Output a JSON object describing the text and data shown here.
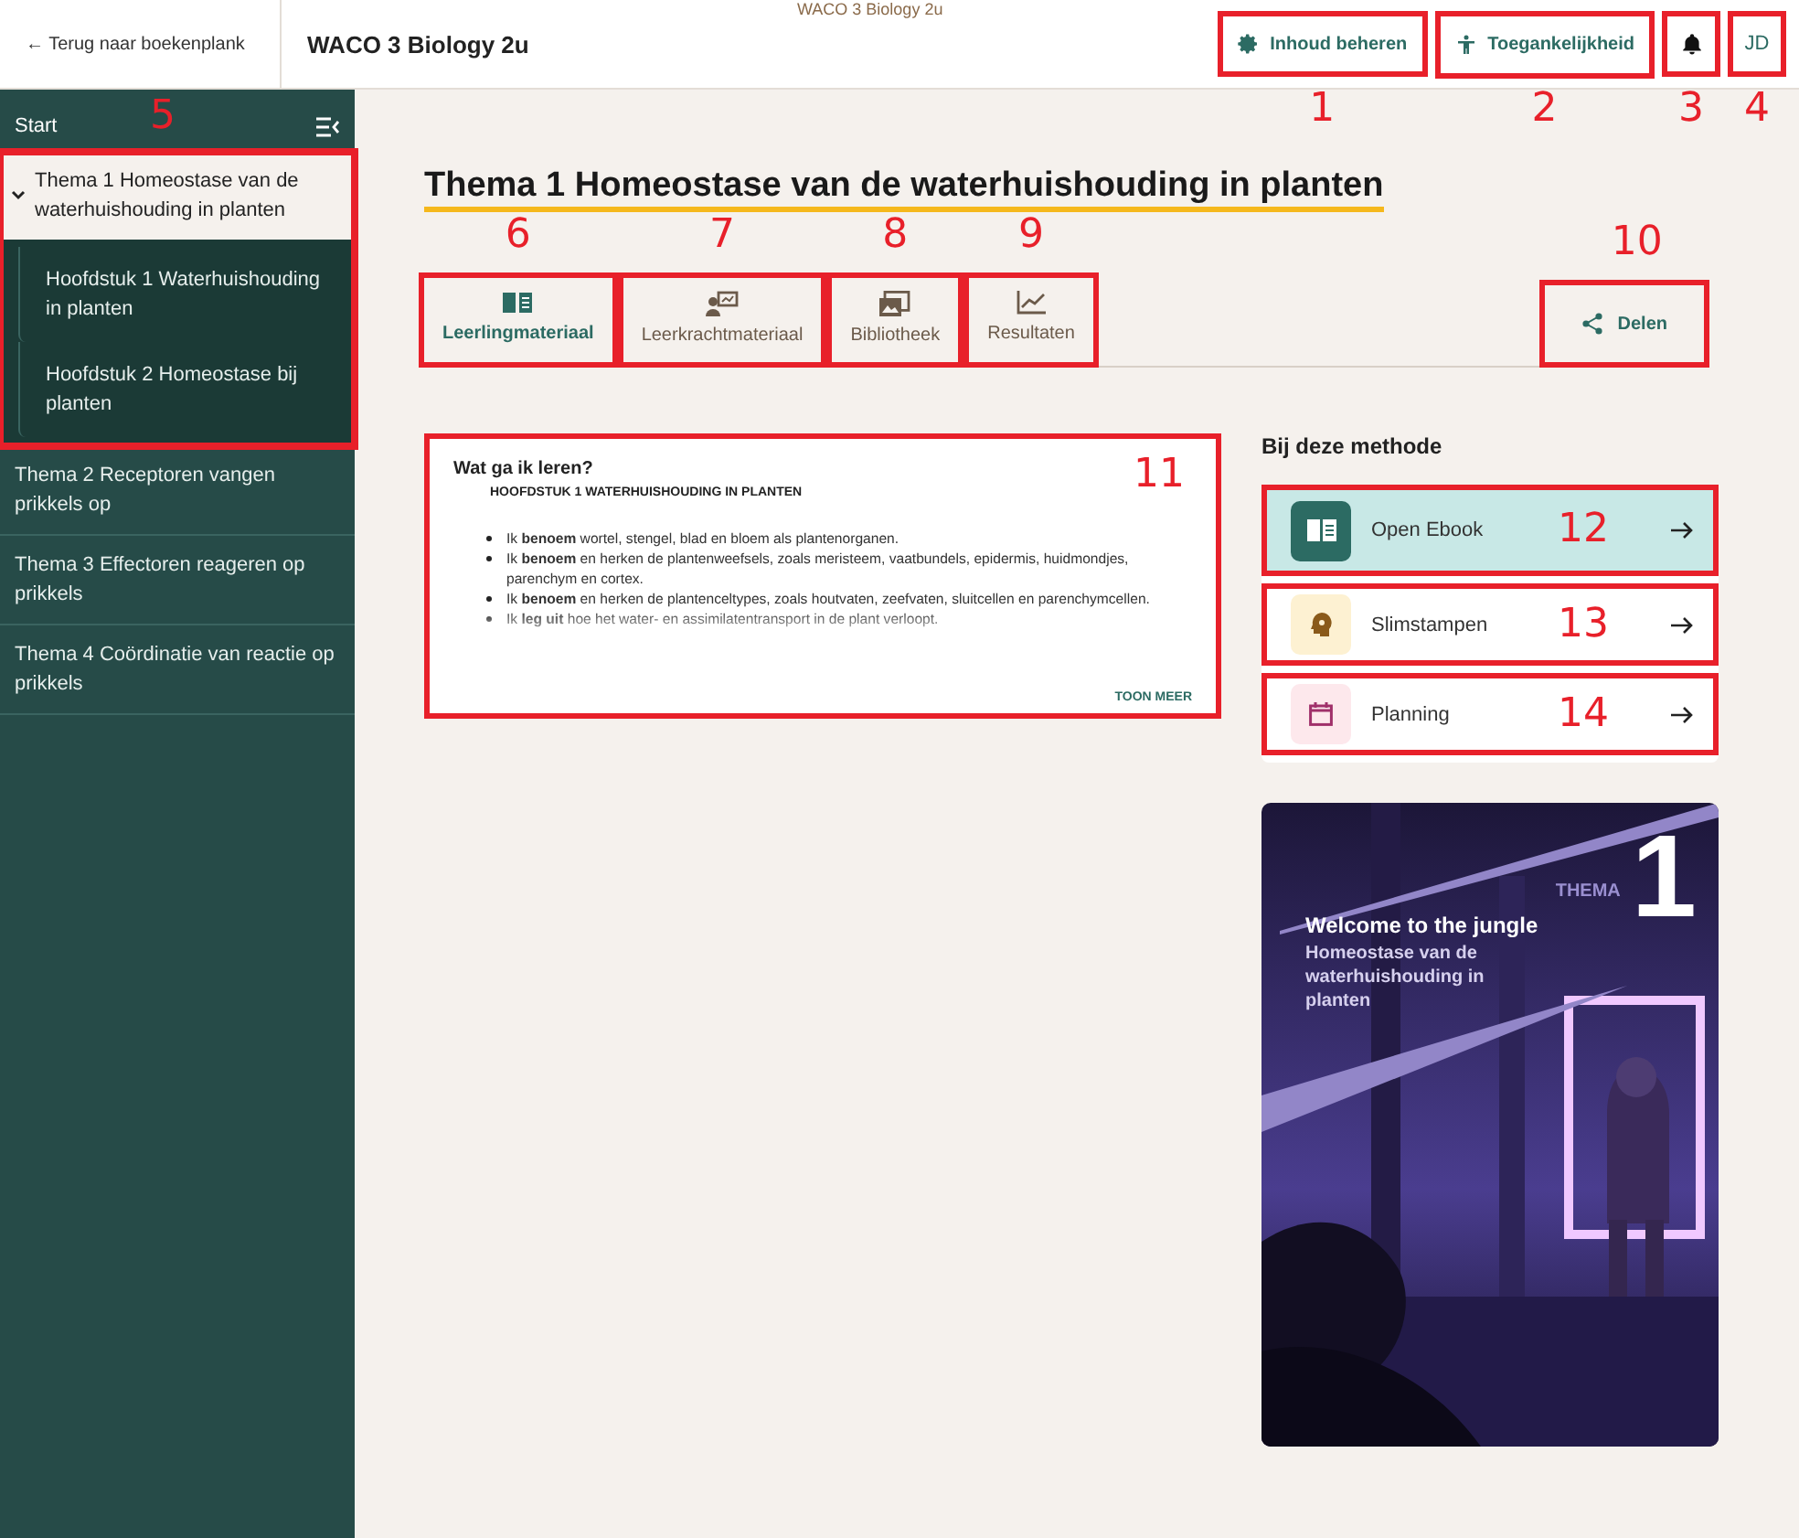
{
  "top_caption": "WACO 3 Biology 2u",
  "header": {
    "back": {
      "arrow": "←",
      "label": "Terug naar boekenplank"
    },
    "title": "WACO 3 Biology 2u",
    "actions": [
      {
        "kind": "button",
        "label": "Inhoud beheren",
        "callout": "1"
      },
      {
        "kind": "button",
        "label": "Toegankelijkheid",
        "callout": "2"
      },
      {
        "kind": "icon",
        "callout": "3"
      },
      {
        "kind": "avatar",
        "label": "JD",
        "callout": "4"
      }
    ]
  },
  "sidebar": {
    "start": "Start",
    "items": [
      {
        "label": "Thema 1 Homeostase van de waterhuishouding in planten",
        "expanded": true,
        "selected": true,
        "callout": "5",
        "children": [
          {
            "label": "Hoofdstuk 1 Waterhuishouding in planten"
          },
          {
            "label": "Hoofdstuk 2 Homeostase bij planten"
          }
        ]
      },
      {
        "label": "Thema 2 Receptoren vangen prikkels op",
        "expanded": false,
        "selected": false
      },
      {
        "label": "Thema 3 Effectoren reageren op prikkels",
        "expanded": false,
        "selected": false
      },
      {
        "label": "Thema 4 Coördinatie van reactie op prikkels",
        "expanded": false,
        "selected": false
      }
    ]
  },
  "page": {
    "title": "Thema 1 Homeostase van de waterhuishouding in planten",
    "tabs": [
      {
        "label": "Leerlingmateriaal",
        "selected": true,
        "callout": "6"
      },
      {
        "label": "Leerkrachtmateriaal",
        "selected": false,
        "callout": "7"
      },
      {
        "label": "Bibliotheek",
        "selected": false,
        "callout": "8"
      },
      {
        "label": "Resultaten",
        "selected": false,
        "callout": "9"
      }
    ],
    "share": {
      "label": "Delen",
      "callout": "10"
    }
  },
  "learn_card": {
    "title": "Wat ga ik leren?",
    "subtitle": "HOOFDSTUK 1 WATERHUISHOUDING IN PLANTEN",
    "callout": "11",
    "bullets": [
      "Ik **benoem** wortel, stengel, blad en bloem als plantenorganen.",
      "Ik **benoem** en herken de plantenweefsels, zoals meristeem, vaatbundels, epidermis, huidmondjes, parenchym en cortex.",
      "Ik **benoem** en herken de plantenceltypes, zoals houtvaten, zeefvaten, sluitcellen en parenchymcellen.",
      "Ik **leg uit** hoe het water- en assimilatentransport in de plant verloopt."
    ],
    "more": "TOON MEER"
  },
  "method": {
    "heading": "Bij deze methode",
    "links": [
      {
        "label": "Open Ebook",
        "selected": true,
        "callout": "12"
      },
      {
        "label": "Slimstampen",
        "selected": false,
        "callout": "13"
      },
      {
        "label": "Planning",
        "selected": false,
        "callout": "14"
      }
    ]
  },
  "cover": {
    "kind": "picture",
    "label": "THEMA",
    "number": "1",
    "title": "Welcome to the jungle",
    "subtitle": "Homeostase van de waterhuishouding in planten"
  }
}
